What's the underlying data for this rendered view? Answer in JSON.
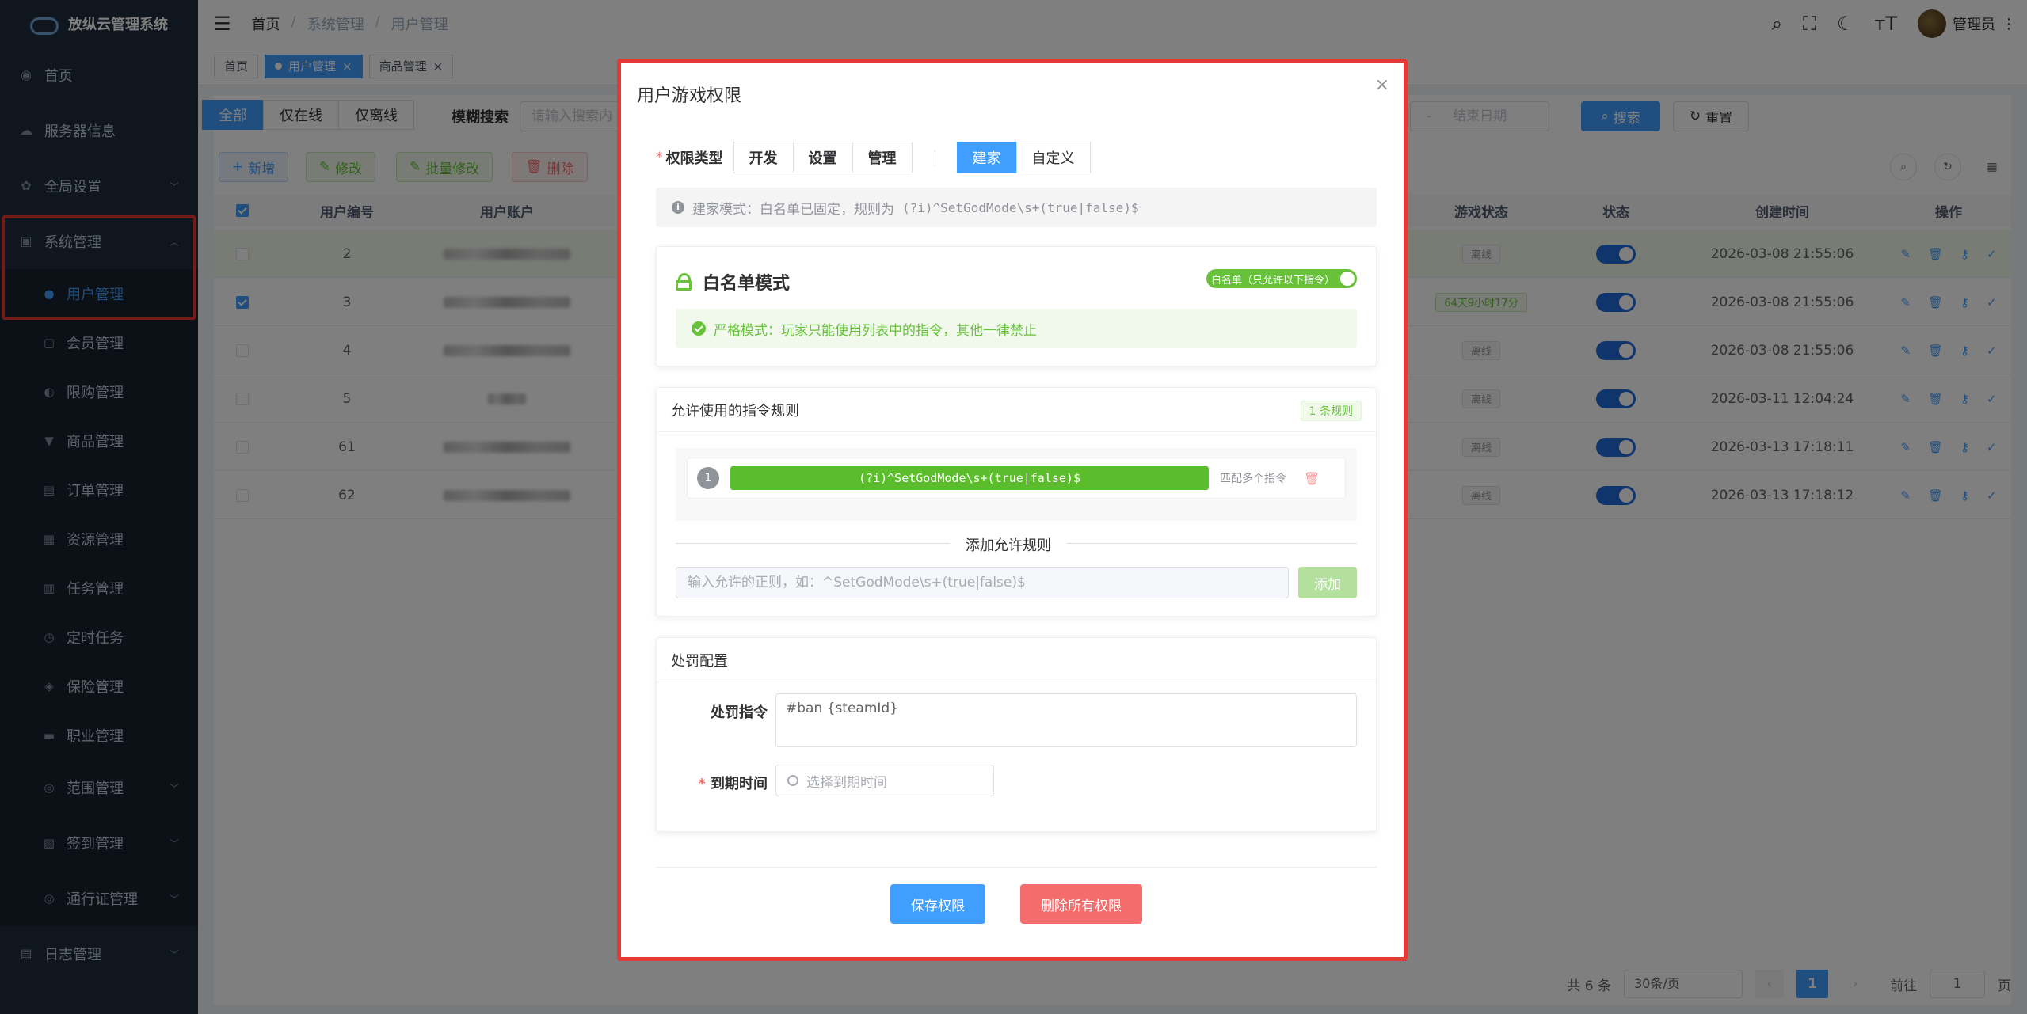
{
  "app": {
    "title": "放纵云管理系统"
  },
  "sidebar": {
    "items": [
      {
        "label": "首页",
        "icon": "dashboard-icon"
      },
      {
        "label": "服务器信息",
        "icon": "cloud-icon"
      },
      {
        "label": "全局设置",
        "icon": "gear-icon"
      },
      {
        "label": "系统管理",
        "icon": "monitor-icon"
      }
    ],
    "sub_items": [
      {
        "label": "用户管理",
        "icon": "user-icon"
      },
      {
        "label": "会员管理",
        "icon": "member-icon"
      },
      {
        "label": "限购管理",
        "icon": "limit-icon"
      },
      {
        "label": "商品管理",
        "icon": "cart-icon"
      },
      {
        "label": "订单管理",
        "icon": "order-icon"
      },
      {
        "label": "资源管理",
        "icon": "resource-icon"
      },
      {
        "label": "任务管理",
        "icon": "task-icon"
      },
      {
        "label": "定时任务",
        "icon": "clock-icon"
      },
      {
        "label": "保险管理",
        "icon": "shield-icon"
      },
      {
        "label": "职业管理",
        "icon": "briefcase-icon"
      },
      {
        "label": "范围管理",
        "icon": "range-icon"
      },
      {
        "label": "签到管理",
        "icon": "calendar-icon"
      },
      {
        "label": "通行证管理",
        "icon": "pass-icon"
      }
    ],
    "log": {
      "label": "日志管理",
      "icon": "log-icon"
    }
  },
  "header": {
    "breadcrumb": [
      "首页",
      "系统管理",
      "用户管理"
    ],
    "user": "管理员"
  },
  "tags": [
    "首页",
    "用户管理",
    "商品管理"
  ],
  "filter": {
    "segments": [
      "全部",
      "仅在线",
      "仅离线"
    ],
    "search_label": "模糊搜索",
    "search_placeholder": "请输入搜索内",
    "date_sep": "-",
    "date_end_placeholder": "结束日期",
    "search_btn": "搜索",
    "reset_btn": "重置"
  },
  "toolbar": {
    "add": "新增",
    "edit": "修改",
    "batch_edit": "批量修改",
    "delete": "删除"
  },
  "table": {
    "headers": {
      "id": "用户编号",
      "account": "用户账户",
      "game_status": "游戏状态",
      "status": "状态",
      "created": "创建时间",
      "ops": "操作"
    },
    "rows": [
      {
        "id": "2",
        "game_status": "离线",
        "created": "2026-03-08 21:55:06",
        "checked": false
      },
      {
        "id": "3",
        "game_status": "64天9小时17分",
        "created": "2026-03-08 21:55:06",
        "checked": true
      },
      {
        "id": "4",
        "game_status": "离线",
        "created": "2026-03-08 21:55:06",
        "checked": false
      },
      {
        "id": "5",
        "game_status": "离线",
        "created": "2026-03-11 12:04:24",
        "checked": false
      },
      {
        "id": "61",
        "game_status": "离线",
        "created": "2026-03-13 17:18:11",
        "checked": false
      },
      {
        "id": "62",
        "game_status": "离线",
        "created": "2026-03-13 17:18:12",
        "checked": false
      }
    ]
  },
  "pagination": {
    "total": "共 6 条",
    "page_size": "30条/页",
    "current": "1",
    "goto_label": "前往",
    "goto_value": "1",
    "page_unit": "页"
  },
  "dialog": {
    "title": "用户游戏权限",
    "close": "×",
    "perm_type_label": "权限类型",
    "perm_types": [
      "开发",
      "设置",
      "管理"
    ],
    "modes": [
      "建家",
      "自定义"
    ],
    "info_text": "建家模式：白名单已固定，规则为",
    "info_regex": "(?i)^SetGodMode\\s+(true|false)$",
    "whitelist_title": "白名单模式",
    "whitelist_switch": "白名单（只允许以下指令）",
    "strict_text": "严格模式：玩家只能使用列表中的指令，其他一律禁止",
    "rules_title": "允许使用的指令规则",
    "rules_count": "1 条规则",
    "rules": [
      {
        "num": "1",
        "pattern": "(?i)^SetGodMode\\s+(true|false)$",
        "hint": "匹配多个指令"
      }
    ],
    "add_rule_divider": "添加允许规则",
    "add_rule_placeholder": "输入允许的正则，如：^SetGodMode\\s+(true|false)$",
    "add_rule_btn": "添加",
    "penalty_title": "处罚配置",
    "penalty_cmd_label": "处罚指令",
    "penalty_cmd_value": "#ban {steamId}",
    "expire_label": "到期时间",
    "expire_placeholder": "选择到期时间",
    "save_btn": "保存权限",
    "delete_all_btn": "删除所有权限"
  }
}
